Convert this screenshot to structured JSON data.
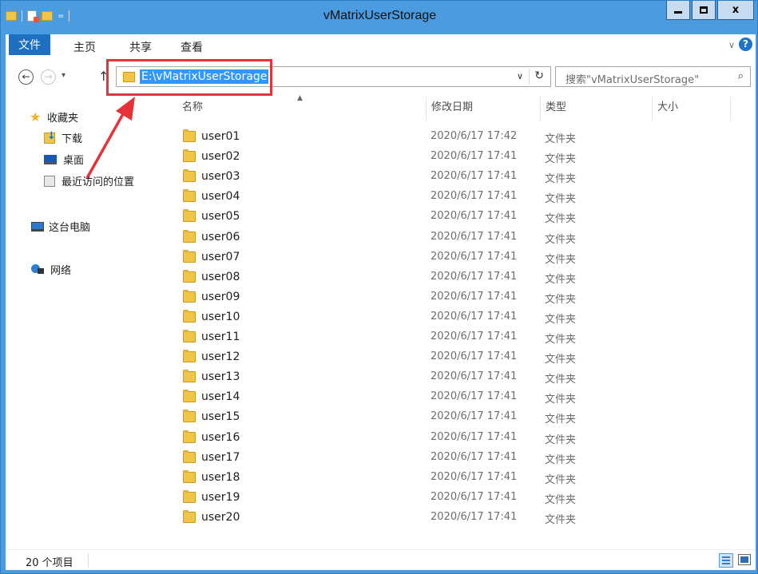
{
  "window": {
    "title": "vMatrixUserStorage"
  },
  "quick_access": {
    "icons": [
      "folder-icon",
      "properties-icon",
      "new-folder-icon",
      "customize-dropdown-icon"
    ],
    "dropdown_glyph": "="
  },
  "window_buttons": {
    "close_label": "x"
  },
  "ribbon": {
    "tabs": [
      "文件",
      "主页",
      "共享",
      "查看"
    ],
    "help_label": "?",
    "expand_glyph": "∨"
  },
  "navigation": {
    "back_glyph": "←",
    "forward_glyph": "→",
    "recent_glyph": "▾",
    "up_glyph": "↑",
    "address_path": "E:\\vMatrixUserStorage",
    "address_dropdown_glyph": "∨",
    "refresh_glyph": "↻",
    "search_placeholder": "搜索\"vMatrixUserStorage\"",
    "search_glyph": "⌕"
  },
  "sidebar": {
    "favorites_label": "收藏夹",
    "favorites": [
      "下载",
      "桌面",
      "最近访问的位置"
    ],
    "this_pc_label": "这台电脑",
    "network_label": "网络"
  },
  "columns": {
    "name": "名称",
    "modified": "修改日期",
    "type": "类型",
    "size": "大小",
    "sort_glyph": "▲"
  },
  "files": [
    {
      "name": "user01",
      "modified": "2020/6/17 17:42",
      "type": "文件夹"
    },
    {
      "name": "user02",
      "modified": "2020/6/17 17:41",
      "type": "文件夹"
    },
    {
      "name": "user03",
      "modified": "2020/6/17 17:41",
      "type": "文件夹"
    },
    {
      "name": "user04",
      "modified": "2020/6/17 17:41",
      "type": "文件夹"
    },
    {
      "name": "user05",
      "modified": "2020/6/17 17:41",
      "type": "文件夹"
    },
    {
      "name": "user06",
      "modified": "2020/6/17 17:41",
      "type": "文件夹"
    },
    {
      "name": "user07",
      "modified": "2020/6/17 17:41",
      "type": "文件夹"
    },
    {
      "name": "user08",
      "modified": "2020/6/17 17:41",
      "type": "文件夹"
    },
    {
      "name": "user09",
      "modified": "2020/6/17 17:41",
      "type": "文件夹"
    },
    {
      "name": "user10",
      "modified": "2020/6/17 17:41",
      "type": "文件夹"
    },
    {
      "name": "user11",
      "modified": "2020/6/17 17:41",
      "type": "文件夹"
    },
    {
      "name": "user12",
      "modified": "2020/6/17 17:41",
      "type": "文件夹"
    },
    {
      "name": "user13",
      "modified": "2020/6/17 17:41",
      "type": "文件夹"
    },
    {
      "name": "user14",
      "modified": "2020/6/17 17:41",
      "type": "文件夹"
    },
    {
      "name": "user15",
      "modified": "2020/6/17 17:41",
      "type": "文件夹"
    },
    {
      "name": "user16",
      "modified": "2020/6/17 17:41",
      "type": "文件夹"
    },
    {
      "name": "user17",
      "modified": "2020/6/17 17:41",
      "type": "文件夹"
    },
    {
      "name": "user18",
      "modified": "2020/6/17 17:41",
      "type": "文件夹"
    },
    {
      "name": "user19",
      "modified": "2020/6/17 17:41",
      "type": "文件夹"
    },
    {
      "name": "user20",
      "modified": "2020/6/17 17:41",
      "type": "文件夹"
    }
  ],
  "status": {
    "item_count": "20 个项目"
  },
  "annotation": {
    "highlight_color": "#e8323a"
  },
  "colors": {
    "title_bar": "#4a9be0",
    "file_tab": "#1d6fc1",
    "selection": "#3297fd",
    "folder": "#f0c64a"
  }
}
